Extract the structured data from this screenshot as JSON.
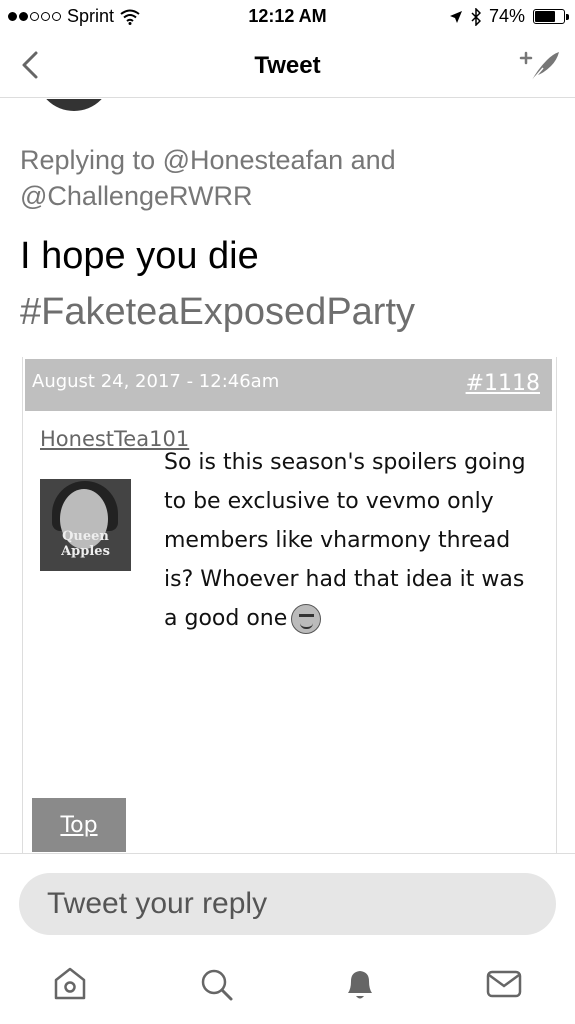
{
  "status_bar": {
    "carrier": "Sprint",
    "time": "12:12 AM",
    "battery_percent": "74%",
    "battery_level": 0.74,
    "signal_bars_filled": 2,
    "signal_bars_total": 5
  },
  "nav": {
    "title": "Tweet",
    "back_icon": "chevron-left-icon",
    "compose_icon": "compose-tweet-icon"
  },
  "tweet": {
    "replying_to": "Replying to @Honesteafan and @ChallengeRWRR",
    "text": "I hope you die",
    "hashtag": "#FaketeaExposedParty"
  },
  "forum_post": {
    "date": "August 24, 2017 - 12:46am",
    "post_number": "#1118",
    "username": "HonestTea101",
    "avatar_caption": "Queen Apples",
    "body": "So is this season's spoilers going to be exclusive to vevmo only members like vharmony thread is? Whoever had that idea it was a good one",
    "top_button": "Top"
  },
  "reply": {
    "placeholder": "Tweet your reply"
  },
  "tab_bar": {
    "items": [
      "home-icon",
      "search-icon",
      "notifications-icon",
      "messages-icon"
    ]
  }
}
